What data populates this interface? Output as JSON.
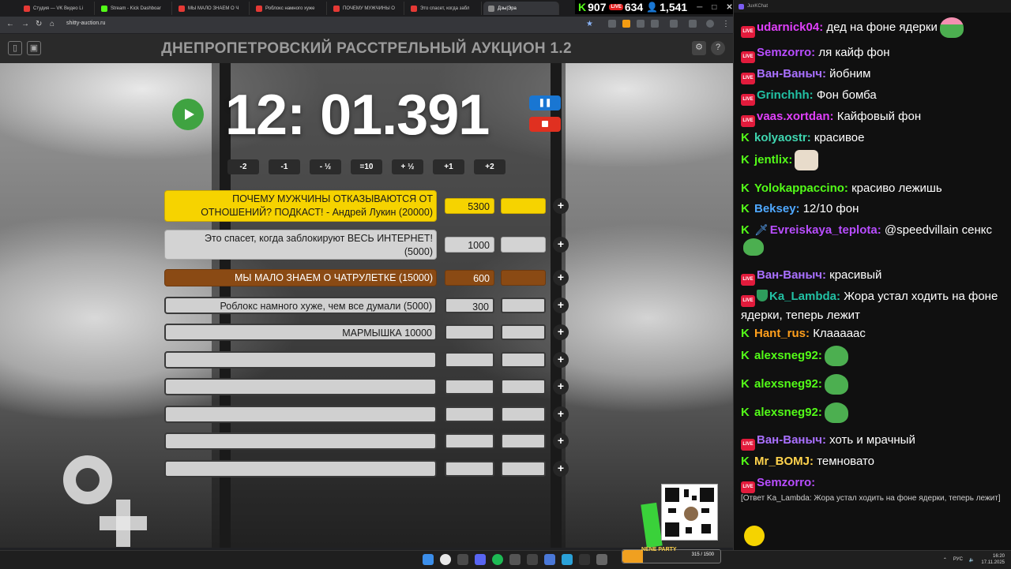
{
  "browser": {
    "tabs": [
      {
        "title": "Студия — VK Видео Li",
        "color": "#e53935"
      },
      {
        "title": "Stream - Kick Dashboar",
        "color": "#53fc18"
      },
      {
        "title": "МЫ МАЛО ЗНАЕМ О Ч",
        "color": "#e53935"
      },
      {
        "title": "Роблокс намного хуже",
        "color": "#e53935"
      },
      {
        "title": "ПОЧЕМУ МУЖЧИНЫ О",
        "color": "#e53935"
      },
      {
        "title": "Это спасет, когда забл",
        "color": "#e53935"
      },
      {
        "title": "Дзы|Эра",
        "color": "#888888"
      }
    ],
    "url": "shitty-auction.ru"
  },
  "overlay": {
    "kick_viewers": "907",
    "live_viewers": "634",
    "other_viewers": "1,541"
  },
  "auction": {
    "title": "ДНЕПРОПЕТРОВСКИЙ РАССТРЕЛЬНЫЙ АУКЦИОН 1.2",
    "timer": "12: 01.391",
    "pause_icon": "❚❚",
    "adjust_buttons": [
      "-2",
      "-1",
      "- ½",
      "=10",
      "+ ½",
      "+1",
      "+2"
    ],
    "lots": [
      {
        "name": "ПОЧЕМУ МУЖЧИНЫ ОТКАЗЫВАЮТСЯ ОТ ОТНОШЕНИЙ? ПОДКАСТ! - Андрей Лукин (20000)",
        "amount": "5300",
        "style": "yellow"
      },
      {
        "name": "Это спасет, когда заблокируют ВЕСЬ ИНТЕРНЕТ! (5000)",
        "amount": "1000",
        "style": "grey"
      },
      {
        "name": "МЫ МАЛО ЗНАЕМ О ЧАТРУЛЕТКЕ (15000)",
        "amount": "600",
        "style": "brown"
      },
      {
        "name": "Роблокс намного хуже, чем все думали (5000)",
        "amount": "300",
        "style": "empty"
      },
      {
        "name": "МАРМЫШКА 10000",
        "amount": "",
        "style": "empty"
      },
      {
        "name": "",
        "amount": "",
        "style": "empty"
      },
      {
        "name": "",
        "amount": "",
        "style": "empty"
      },
      {
        "name": "",
        "amount": "",
        "style": "empty"
      },
      {
        "name": "",
        "amount": "",
        "style": "empty"
      },
      {
        "name": "",
        "amount": "",
        "style": "empty"
      }
    ],
    "add_label": "+"
  },
  "chat": {
    "window_title": "JuxKChat",
    "messages": [
      {
        "platform": "live",
        "user": "udarnick04:",
        "color": "#e040fb",
        "text": "дед на фоне ядерки",
        "emote": "pepe-heart"
      },
      {
        "platform": "live",
        "user": "Semzorro:",
        "color": "#b84dff",
        "text": "ля кайф фон"
      },
      {
        "platform": "live",
        "user": "Ван-Ваныч:",
        "color": "#a970ff",
        "text": "йобним"
      },
      {
        "platform": "live",
        "user": "Grinchhh:",
        "color": "#22c1a4",
        "text": "Фон бомба"
      },
      {
        "platform": "live",
        "user": "vaas.xortdan:",
        "color": "#e040fb",
        "text": "Кайфовый фон"
      },
      {
        "platform": "kick",
        "user": "kolyaostr:",
        "color": "#3fd6b0",
        "text": "красивое"
      },
      {
        "platform": "kick",
        "user": "jentlix:",
        "color": "#53fc18",
        "text": "",
        "emote": "cat"
      },
      {
        "platform": "kick",
        "user": "Yolokappaccino:",
        "color": "#53fc18",
        "text": "красиво лежишь"
      },
      {
        "platform": "kick",
        "user": "Beksey:",
        "color": "#4fa8ff",
        "text": "12/10 фон"
      },
      {
        "platform": "kick",
        "user": "Evreiskaya_teplota:",
        "color": "#b84dff",
        "text": "@speedvillain сенкс",
        "emote": "pepe"
      },
      {
        "platform": "live",
        "user": "Ван-Ваныч:",
        "color": "#a970ff",
        "text": "красивый"
      },
      {
        "platform": "live",
        "user": "Ka_Lambda:",
        "color": "#22c1a4",
        "text": "Жора устал ходить на фоне ядерки, теперь лежит"
      },
      {
        "platform": "kick",
        "user": "Hant_rus:",
        "color": "#ff9f1c",
        "text": "Клааааас"
      },
      {
        "platform": "kick",
        "user": "alexsneg92:",
        "color": "#53fc18",
        "text": "",
        "emote": "pepe"
      },
      {
        "platform": "kick",
        "user": "alexsneg92:",
        "color": "#53fc18",
        "text": "",
        "emote": "pepe"
      },
      {
        "platform": "kick",
        "user": "alexsneg92:",
        "color": "#53fc18",
        "text": "",
        "emote": "pepe"
      },
      {
        "platform": "live",
        "user": "Ван-Ваныч:",
        "color": "#a970ff",
        "text": "хоть и мрачный"
      },
      {
        "platform": "kick",
        "user": "Mr_BOMJ:",
        "color": "#ffd34d",
        "text": "темновато"
      },
      {
        "platform": "live",
        "user": "Semzorro:",
        "color": "#b84dff",
        "text": ""
      }
    ],
    "reply": "[Ответ Ka_Lambda: Жора устал ходить на фоне ядерки, теперь лежит]"
  },
  "taskbar": {
    "party_label": "NENE PARTY",
    "party_count": "315 / 1500",
    "party_progress": 0.21,
    "lang": "РУС",
    "time": "16:20",
    "date": "17.11.2025"
  }
}
